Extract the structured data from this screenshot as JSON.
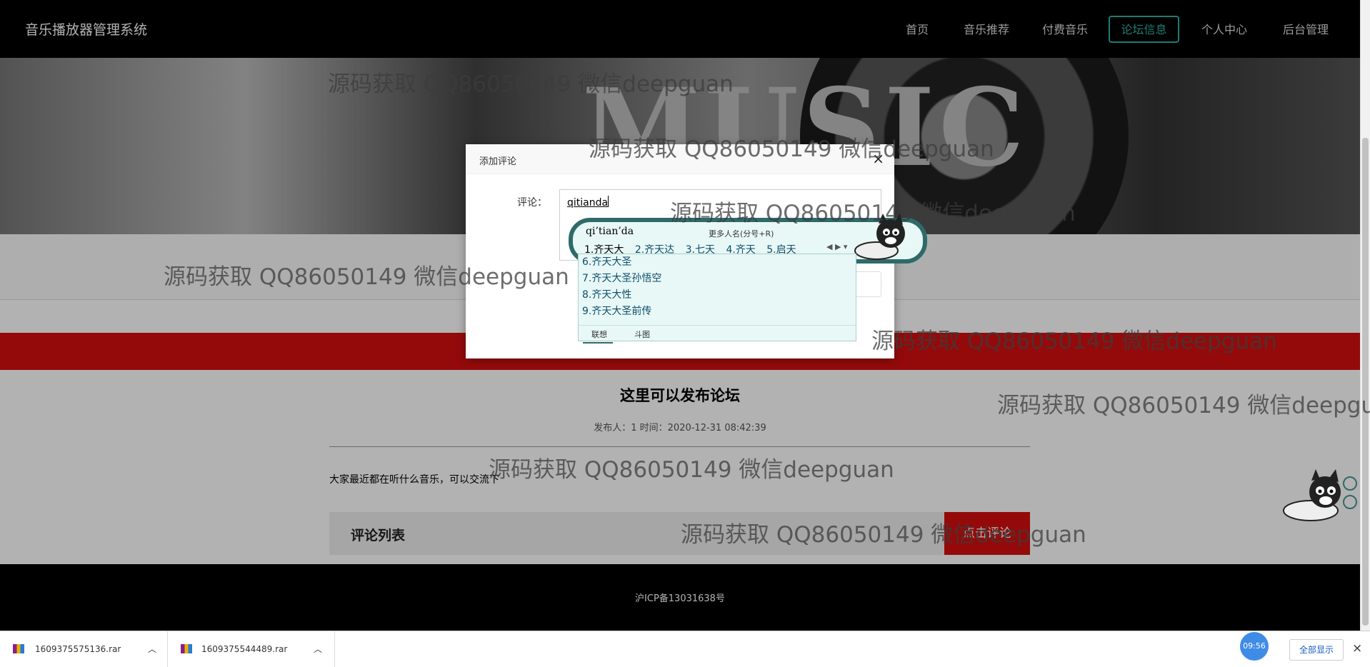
{
  "brand": "音乐播放器管理系统",
  "nav": [
    {
      "label": "首页",
      "active": false
    },
    {
      "label": "音乐推荐",
      "active": false
    },
    {
      "label": "付费音乐",
      "active": false
    },
    {
      "label": "论坛信息",
      "active": true
    },
    {
      "label": "个人中心",
      "active": false
    },
    {
      "label": "后台管理",
      "active": false
    }
  ],
  "banner": {
    "word": "MUSIC"
  },
  "post": {
    "title": "这里可以发布论坛",
    "meta": "发布人：1 时间：2020-12-31 08:42:39",
    "body": "大家最近都在听什么音乐，可以交流下"
  },
  "comments": {
    "header": "评论列表",
    "button": "点击评论"
  },
  "footer": {
    "icp": "沪ICP备13031638号"
  },
  "dialog": {
    "title": "添加评论",
    "close": "×",
    "field_label": "评论：",
    "typed_text": "qitianda"
  },
  "ime": {
    "pinyin": "qi’tian’da",
    "hint": "更多人名(分号+R)",
    "candidates": [
      "1.齐天大",
      "2.齐天达",
      "3.七天",
      "4.齐天",
      "5.启天"
    ],
    "more": [
      "6.齐天大圣",
      "7.齐天大圣孙悟空",
      "8.齐天大性",
      "9.齐天大圣前传"
    ],
    "tabs": [
      "联想",
      "斗图"
    ]
  },
  "watermark": "源码获取 QQ86050149 微信deepguan",
  "downloads": [
    {
      "name": "1609375575136.rar"
    },
    {
      "name": "1609375544489.rar"
    }
  ],
  "taskbar": {
    "time": "09:56",
    "show_all": "全部显示",
    "close": "×"
  },
  "colors": {
    "accent": "#2bb3a4",
    "red": "#d40f0f",
    "nav_bg": "#000000"
  }
}
